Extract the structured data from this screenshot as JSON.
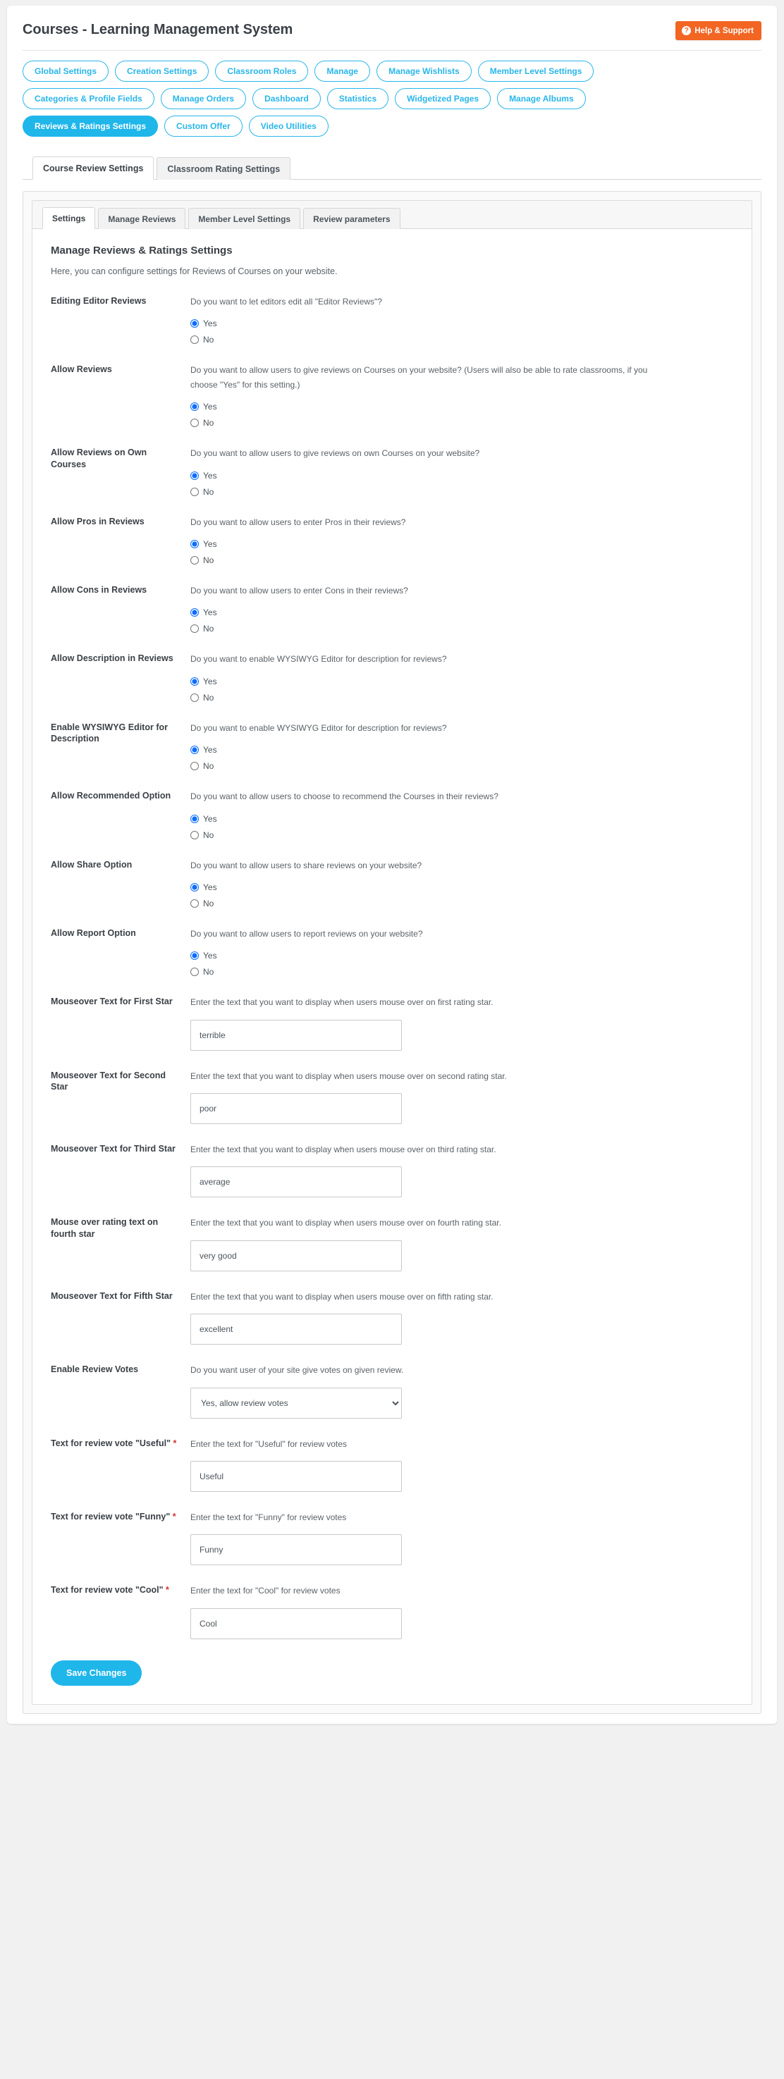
{
  "header": {
    "title": "Courses - Learning Management System",
    "help_button": "Help & Support",
    "help_icon": "question-circle-icon"
  },
  "pill_nav": {
    "rows": [
      [
        {
          "label": "Global Settings",
          "active": false
        },
        {
          "label": "Creation Settings",
          "active": false
        },
        {
          "label": "Classroom Roles",
          "active": false
        },
        {
          "label": "Manage",
          "active": false
        },
        {
          "label": "Manage Wishlists",
          "active": false
        },
        {
          "label": "Member Level Settings",
          "active": false
        }
      ],
      [
        {
          "label": "Categories & Profile Fields",
          "active": false
        },
        {
          "label": "Manage Orders",
          "active": false
        },
        {
          "label": "Dashboard",
          "active": false
        },
        {
          "label": "Statistics",
          "active": false
        },
        {
          "label": "Widgetized Pages",
          "active": false
        },
        {
          "label": "Manage Albums",
          "active": false
        }
      ],
      [
        {
          "label": "Reviews & Ratings Settings",
          "active": true
        },
        {
          "label": "Custom Offer",
          "active": false
        },
        {
          "label": "Video Utilities",
          "active": false
        }
      ]
    ]
  },
  "level1_tabs": [
    {
      "label": "Course Review Settings",
      "active": true
    },
    {
      "label": "Classroom Rating Settings",
      "active": false
    }
  ],
  "level2_tabs": [
    {
      "label": "Settings",
      "active": true
    },
    {
      "label": "Manage Reviews",
      "active": false
    },
    {
      "label": "Member Level Settings",
      "active": false
    },
    {
      "label": "Review parameters",
      "active": false
    }
  ],
  "form": {
    "section_title": "Manage Reviews & Ratings Settings",
    "section_desc": "Here, you can configure settings for Reviews of Courses on your website.",
    "yes_label": "Yes",
    "no_label": "No",
    "rows": [
      {
        "label": "Editing Editor Reviews",
        "help": "Do you want to let editors edit all \"Editor Reviews\"?",
        "type": "radio",
        "selected": "yes"
      },
      {
        "label": "Allow Reviews",
        "help": "Do you want to allow users to give reviews on Courses on your website? (Users will also be able to rate classrooms, if you choose \"Yes\" for this setting.)",
        "type": "radio",
        "selected": "yes"
      },
      {
        "label": "Allow Reviews on Own Courses",
        "help": "Do you want to allow users to give reviews on own Courses on your website?",
        "type": "radio",
        "selected": "yes"
      },
      {
        "label": "Allow Pros in Reviews",
        "help": "Do you want to allow users to enter Pros in their reviews?",
        "type": "radio",
        "selected": "yes"
      },
      {
        "label": "Allow Cons in Reviews",
        "help": "Do you want to allow users to enter Cons in their reviews?",
        "type": "radio",
        "selected": "yes"
      },
      {
        "label": "Allow Description in Reviews",
        "help": "Do you want to enable WYSIWYG Editor for description for reviews?",
        "type": "radio",
        "selected": "yes"
      },
      {
        "label": "Enable WYSIWYG Editor for Description",
        "help": "Do you want to enable WYSIWYG Editor for description for reviews?",
        "type": "radio",
        "selected": "yes"
      },
      {
        "label": "Allow Recommended Option",
        "help": "Do you want to allow users to choose to recommend the Courses in their reviews?",
        "type": "radio",
        "selected": "yes"
      },
      {
        "label": "Allow Share Option",
        "help": "Do you want to allow users to share reviews on your website?",
        "type": "radio",
        "selected": "yes"
      },
      {
        "label": "Allow Report Option",
        "help": "Do you want to allow users to report reviews on your website?",
        "type": "radio",
        "selected": "yes"
      },
      {
        "label": "Mouseover Text for First Star",
        "help": "Enter the text that you want to display when users mouse over on first rating star.",
        "type": "text",
        "value": "terrible"
      },
      {
        "label": "Mouseover Text for Second Star",
        "help": "Enter the text that you want to display when users mouse over on second rating star.",
        "type": "text",
        "value": "poor"
      },
      {
        "label": "Mouseover Text for Third Star",
        "help": "Enter the text that you want to display when users mouse over on third rating star.",
        "type": "text",
        "value": "average"
      },
      {
        "label": "Mouse over rating text on fourth star",
        "help": "Enter the text that you want to display when users mouse over on fourth rating star.",
        "type": "text",
        "value": "very good"
      },
      {
        "label": "Mouseover Text for Fifth Star",
        "help": "Enter the text that you want to display when users mouse over on fifth rating star.",
        "type": "text",
        "value": "excellent"
      },
      {
        "label": "Enable Review Votes",
        "help": "Do you want user of your site give votes on given review.",
        "type": "select",
        "value": "Yes, allow review votes",
        "options": [
          "Yes, allow review votes"
        ]
      },
      {
        "label": "Text for review vote \"Useful\"",
        "required": true,
        "help": "Enter the text for \"Useful\" for review votes",
        "type": "text",
        "value": "Useful"
      },
      {
        "label": "Text for review vote \"Funny\"",
        "required": true,
        "help": "Enter the text for \"Funny\" for review votes",
        "type": "text",
        "value": "Funny"
      },
      {
        "label": "Text for review vote \"Cool\"",
        "required": true,
        "help": "Enter the text for \"Cool\" for review votes",
        "type": "text",
        "value": "Cool"
      }
    ],
    "save_label": "Save Changes"
  },
  "colors": {
    "accent": "#1fb6ea",
    "accent_border": "#29b6ea",
    "help_orange": "#f26522",
    "required_red": "#d63030"
  }
}
